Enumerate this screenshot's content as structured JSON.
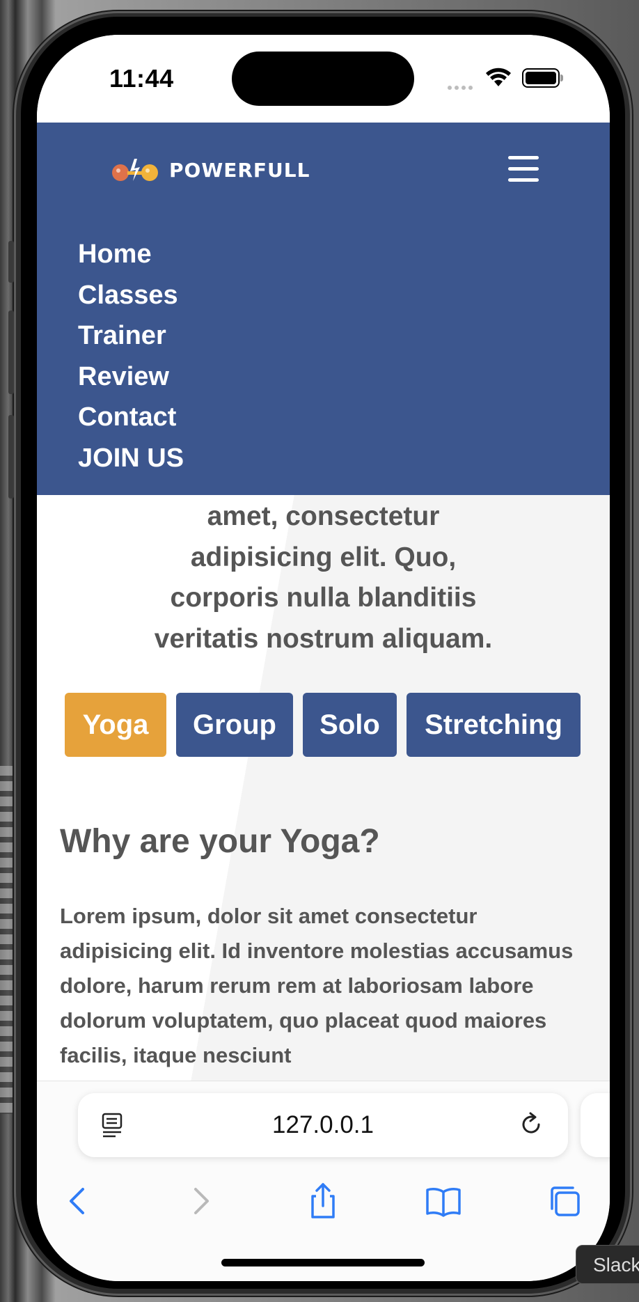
{
  "status_bar": {
    "time": "11:44"
  },
  "brand": {
    "name": "POWERFULL"
  },
  "nav": {
    "items": [
      {
        "label": "Home"
      },
      {
        "label": "Classes"
      },
      {
        "label": "Trainer"
      },
      {
        "label": "Review"
      },
      {
        "label": "Contact"
      },
      {
        "label": "JOIN US"
      }
    ]
  },
  "intro": {
    "lines": [
      "amet, consectetur",
      "adipisicing elit. Quo,",
      "corporis nulla blanditiis",
      "veritatis nostrum aliquam."
    ]
  },
  "tabs": [
    {
      "label": "Yoga",
      "active": true
    },
    {
      "label": "Group",
      "active": false
    },
    {
      "label": "Solo",
      "active": false
    },
    {
      "label": "Stretching",
      "active": false
    }
  ],
  "section": {
    "heading": "Why are your Yoga?",
    "paragraph": "Lorem ipsum, dolor sit amet consectetur adipisicing elit. Id inventore molestias accusamus dolore, harum rerum rem at laboriosam labore dolorum voluptatem, quo placeat quod maiores facilis, itaque nesciunt"
  },
  "browser": {
    "url": "127.0.0.1"
  },
  "tooltip": {
    "text": "Slack"
  },
  "colors": {
    "header": "#3c568e",
    "accent": "#e6a23b",
    "text": "#555555"
  }
}
